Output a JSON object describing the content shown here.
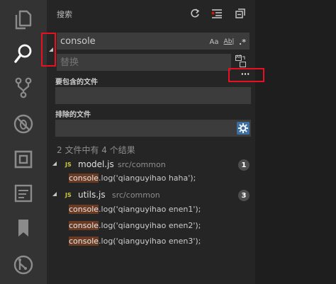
{
  "activity_bar": {
    "items": [
      {
        "name": "explorer-icon"
      },
      {
        "name": "search-icon"
      },
      {
        "name": "source-control-icon"
      },
      {
        "name": "debug-icon"
      },
      {
        "name": "extensions-icon"
      },
      {
        "name": "terminal-panel-icon"
      },
      {
        "name": "bookmark-icon"
      },
      {
        "name": "gitlens-icon"
      }
    ]
  },
  "search_panel": {
    "title": "搜索",
    "actions": [
      "refresh-icon",
      "clear-results-icon",
      "collapse-all-icon"
    ],
    "search_input": {
      "value": "console",
      "options": [
        "Aa",
        "Ab|",
        ".*"
      ]
    },
    "replace_input": {
      "value": "替换",
      "replace_all_glyph": "AB"
    },
    "more_options_label": "···",
    "include_label": "要包含的文件",
    "include_value": "",
    "exclude_label": "排除的文件",
    "exclude_value": "",
    "summary": "2 文件中有 4 个结果",
    "results": [
      {
        "icon": "JS",
        "file": "model.js",
        "path": "src/common",
        "count": "1",
        "matches": [
          {
            "match": "console",
            "rest": ".log('qianguyihao haha');"
          }
        ]
      },
      {
        "icon": "JS",
        "file": "utils.js",
        "path": "src/common",
        "count": "3",
        "matches": [
          {
            "match": "console",
            "rest": ".log('qianguyihao enen1');"
          },
          {
            "match": "console",
            "rest": ".log('qianguyihao enen2');"
          },
          {
            "match": "console",
            "rest": ".log('qianguyihao enen3');"
          }
        ]
      }
    ]
  },
  "colors": {
    "activity_bg": "#333333",
    "sidebar_bg": "#252526",
    "input_bg": "#3c3c3c",
    "match_highlight": "#6b3a22",
    "annotation": "#e81123"
  }
}
